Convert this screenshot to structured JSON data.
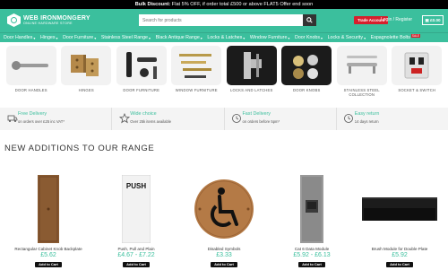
{
  "topbar": {
    "strong": "Bulk Discount:",
    "text": " Flat 5% OFF, if order total £500 or above FLAT5 Offer end soon"
  },
  "header": {
    "logo_line1": "WEB IRONMONGERY",
    "logo_line2": "ONLINE HARDWARE STORE",
    "search_placeholder": "Search for products",
    "trade_label": "Trade Account",
    "login_label": "Login / Register",
    "cart_label": "£0.00"
  },
  "nav": {
    "items": [
      "Door Handles",
      "Hinges",
      "Door Furniture",
      "Stainless Steel Range",
      "Black Antique Range",
      "Locks & Latches",
      "Window Furniture",
      "Door Knobs",
      "Locks & Security",
      "Espagnolette Bolts"
    ],
    "sale_badge": "SALE"
  },
  "categories": [
    {
      "label": "DOOR HANDLES"
    },
    {
      "label": "HINGES"
    },
    {
      "label": "DOOR FURNITURE"
    },
    {
      "label": "WINDOW FURNITURE"
    },
    {
      "label": "LOCKS AND LATCHES"
    },
    {
      "label": "DOOR KNOBS"
    },
    {
      "label": "STAINLESS STEEL COLLECTION"
    },
    {
      "label": "SOCKET & SWITCH"
    }
  ],
  "features": [
    {
      "title": "Free Delivery",
      "sub": "on orders over £25 inc VAT*",
      "icon": "truck-icon"
    },
    {
      "title": "Wide choice",
      "sub": "Over 25k items available",
      "icon": "star-icon"
    },
    {
      "title": "Fast Delivery",
      "sub": "on orders before 5pm*",
      "icon": "clock-icon"
    },
    {
      "title": "Easy return",
      "sub": "14 days return",
      "icon": "clock-icon"
    }
  ],
  "section_title": "NEW ADDITIONS TO OUR RANGE",
  "products": [
    {
      "name": "Rectangular Cabinet Knob Backplate",
      "price": "£5.62",
      "button": "Add to Cart"
    },
    {
      "name": "Push, Pull and Plain",
      "price": "£4.67 - £7.22",
      "button": "Add to Cart",
      "sign_text": "PUSH"
    },
    {
      "name": "Disabled Symbols",
      "price": "£3.33",
      "button": "Add to Cart"
    },
    {
      "name": "Cat 6 Data Module",
      "price": "£5.92 - £6.13",
      "button": "Add to Cart"
    },
    {
      "name": "Brush Module for Double Plate",
      "price": "£5.92",
      "button": "Add to Cart"
    }
  ],
  "colors": {
    "brand": "#3bbf9d",
    "sale": "#d61f2c",
    "topbar": "#000000"
  }
}
